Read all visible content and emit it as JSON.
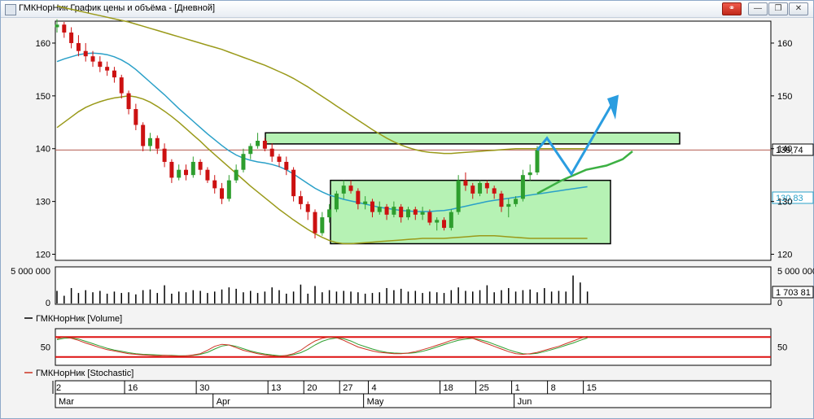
{
  "window": {
    "title": "ГМКНорНик График цены и объёма - [Дневной]",
    "buttons": [
      "link-icon",
      "minimize-icon",
      "restore-icon",
      "close-icon"
    ]
  },
  "colors": {
    "up": "#2e9e2e",
    "down": "#cc1111",
    "ma": "#2aa0c8",
    "bands": "#9a9a1a",
    "forecast_green": "#3cb043",
    "forecast_blue": "#2a9de0",
    "zone_fill": "#b6f2b4",
    "level_line": "#b55b50",
    "stoch_bounds": "#dd1111",
    "stoch_k": "#cc3322",
    "stoch_d": "#2e9e2e"
  },
  "chart_data": [
    {
      "type": "candlestick",
      "title": "ГМКНорНик",
      "y_ticks_left": [
        "160",
        "150",
        "140",
        "130",
        "120"
      ],
      "y_ticks_right": [
        "160",
        "150",
        "140",
        "130",
        "120"
      ],
      "ylim": [
        119,
        164
      ],
      "last_price_label": "139,74",
      "ma_label": "130,83",
      "horizontal_level": 139.74,
      "x": [
        "2",
        "3",
        "4",
        "5",
        "6",
        "9",
        "10",
        "11",
        "12",
        "13",
        "16",
        "17",
        "18",
        "19",
        "20",
        "23",
        "24",
        "25",
        "26",
        "27",
        "30",
        "31",
        "1",
        "2",
        "3",
        "6",
        "7",
        "8",
        "9",
        "10",
        "13",
        "14",
        "15",
        "16",
        "17",
        "20",
        "21",
        "22",
        "23",
        "24",
        "27",
        "28",
        "29",
        "30",
        "4",
        "5",
        "6",
        "7",
        "8",
        "11",
        "12",
        "13",
        "14",
        "15",
        "18",
        "19",
        "20",
        "21",
        "22",
        "25",
        "26",
        "27",
        "28",
        "29",
        "1",
        "2",
        "3",
        "4",
        "5",
        "8",
        "9",
        "10",
        "11",
        "12",
        "15"
      ],
      "ohlc": [
        [
          163,
          164.5,
          162,
          163.5
        ],
        [
          163.5,
          164,
          161,
          162
        ],
        [
          162,
          163,
          159,
          160
        ],
        [
          160,
          161.5,
          157.5,
          158.5
        ],
        [
          158.5,
          160,
          156.5,
          157.5
        ],
        [
          157.5,
          158.5,
          155.5,
          156.5
        ],
        [
          156.5,
          157.5,
          154.5,
          155.5
        ],
        [
          155.5,
          156.5,
          153.8,
          154.8
        ],
        [
          154.8,
          155.5,
          152.5,
          153.5
        ],
        [
          153.5,
          154,
          149.5,
          150.5
        ],
        [
          150.5,
          151,
          146.5,
          147.5
        ],
        [
          147.5,
          148.5,
          143.5,
          144.5
        ],
        [
          144.5,
          145,
          139.5,
          140.5
        ],
        [
          140.5,
          143,
          139.5,
          142
        ],
        [
          142,
          142.5,
          139,
          140
        ],
        [
          140,
          141,
          136.5,
          137.5
        ],
        [
          137.5,
          138,
          133.5,
          134.5
        ],
        [
          134.5,
          137,
          134,
          136
        ],
        [
          136,
          137,
          134,
          135
        ],
        [
          135,
          138.5,
          134.5,
          137.5
        ],
        [
          137.5,
          138,
          135,
          136
        ],
        [
          136,
          136.5,
          133.5,
          134
        ],
        [
          134,
          135,
          131.5,
          132.5
        ],
        [
          132.5,
          133.5,
          129.5,
          130.5
        ],
        [
          130.5,
          135,
          130,
          134
        ],
        [
          134,
          137,
          133.5,
          136
        ],
        [
          136,
          140,
          135.5,
          139
        ],
        [
          139,
          141,
          138,
          140.5
        ],
        [
          140.5,
          143,
          140,
          141.5
        ],
        [
          141.5,
          142,
          139.5,
          140
        ],
        [
          140,
          141,
          137.5,
          138.5
        ],
        [
          138.5,
          139,
          136.5,
          137.5
        ],
        [
          137.5,
          138.5,
          135,
          136
        ],
        [
          136,
          136.5,
          130,
          131
        ],
        [
          131,
          132,
          128.5,
          129.5
        ],
        [
          129.5,
          130,
          126.5,
          128
        ],
        [
          128,
          128.5,
          123,
          124
        ],
        [
          124,
          128,
          123.5,
          127
        ],
        [
          127,
          129.5,
          126,
          128.5
        ],
        [
          128.5,
          132,
          128,
          131.5
        ],
        [
          131.5,
          134,
          130.5,
          133
        ],
        [
          133,
          134,
          131.5,
          132
        ],
        [
          132,
          132.5,
          128.5,
          129.5
        ],
        [
          129.5,
          131,
          128.5,
          130
        ],
        [
          130,
          130.5,
          127,
          128
        ],
        [
          128,
          130,
          127.5,
          129
        ],
        [
          129,
          129.5,
          126.5,
          127.5
        ],
        [
          127.5,
          130,
          127,
          129
        ],
        [
          129,
          129.5,
          126,
          127
        ],
        [
          127,
          129,
          126.5,
          128.5
        ],
        [
          128.5,
          129,
          126.5,
          127.5
        ],
        [
          127.5,
          129,
          126.5,
          128
        ],
        [
          128,
          128.5,
          125.5,
          126
        ],
        [
          126,
          127,
          124.5,
          126.5
        ],
        [
          126.5,
          127,
          124.5,
          125
        ],
        [
          125,
          128.5,
          124.5,
          128
        ],
        [
          128,
          135,
          127.5,
          134
        ],
        [
          134,
          135.5,
          132,
          133
        ],
        [
          133,
          133.5,
          130.5,
          131.5
        ],
        [
          131.5,
          134,
          131,
          133.5
        ],
        [
          133.5,
          134,
          131.5,
          132.5
        ],
        [
          132.5,
          133,
          130.5,
          131.5
        ],
        [
          131.5,
          132,
          128,
          129
        ],
        [
          129,
          130.5,
          127,
          129.5
        ],
        [
          129.5,
          131,
          129,
          130.5
        ],
        [
          130.5,
          136,
          130,
          135
        ],
        [
          135,
          137,
          134,
          135.5
        ],
        [
          135.5,
          140.5,
          135,
          139.74
        ]
      ],
      "ma": [
        156.5,
        157,
        157.4,
        157.8,
        158,
        158.1,
        158,
        157.8,
        157.4,
        156.8,
        156,
        155,
        153.8,
        152.6,
        151.4,
        150.2,
        148.9,
        147.6,
        146.4,
        145.2,
        144,
        142.8,
        141.7,
        140.6,
        139.6,
        138.8,
        138.2,
        137.8,
        137.5,
        137.3,
        137,
        136.6,
        136,
        135.2,
        134.3,
        133.4,
        132.5,
        131.8,
        131.2,
        130.8,
        130.4,
        130.1,
        129.8,
        129.5,
        129.2,
        128.9,
        128.7,
        128.5,
        128.3,
        128.2,
        128.1,
        128.1,
        128.1,
        128.2,
        128.3,
        128.5,
        128.8,
        129.1,
        129.4,
        129.7,
        130,
        130.2,
        130.4,
        130.6,
        130.8,
        131,
        131.2,
        131.4,
        131.6,
        131.8,
        132,
        132.2,
        132.4,
        132.6,
        132.8
      ],
      "upper_band": [
        167,
        166.7,
        166.4,
        166.1,
        165.8,
        165.5,
        165.2,
        164.9,
        164.6,
        164.3,
        164,
        163.6,
        163.2,
        162.8,
        162.4,
        162,
        161.6,
        161.2,
        160.8,
        160.4,
        160,
        159.6,
        159.2,
        158.8,
        158.3,
        157.8,
        157.3,
        156.8,
        156.3,
        155.8,
        155.2,
        154.6,
        154,
        153.3,
        152.5,
        151.7,
        150.8,
        149.9,
        149,
        148.1,
        147.2,
        146.3,
        145.4,
        144.5,
        143.6,
        142.8,
        142,
        141.3,
        140.7,
        140.2,
        139.8,
        139.5,
        139.3,
        139.2,
        139.1,
        139.1,
        139.2,
        139.3,
        139.4,
        139.5,
        139.6,
        139.7,
        139.8,
        139.9,
        140,
        140,
        140,
        140,
        140,
        140,
        140,
        140,
        140,
        140,
        140
      ],
      "lower_band": [
        144,
        145,
        146,
        147,
        147.8,
        148.4,
        148.9,
        149.3,
        149.6,
        149.8,
        150,
        149.8,
        149.4,
        148.8,
        148,
        147.1,
        146.1,
        145,
        143.8,
        142.6,
        141.4,
        140.1,
        138.9,
        137.7,
        136.5,
        135.3,
        134.1,
        132.9,
        131.8,
        130.7,
        129.6,
        128.5,
        127.5,
        126.5,
        125.6,
        124.7,
        123.9,
        123.2,
        122.6,
        122.2,
        122,
        122,
        122.1,
        122.2,
        122.3,
        122.4,
        122.5,
        122.6,
        122.7,
        122.8,
        122.9,
        123,
        123,
        123,
        123,
        123.1,
        123.2,
        123.3,
        123.4,
        123.5,
        123.5,
        123.5,
        123.4,
        123.3,
        123.2,
        123.1,
        123,
        123,
        123,
        123,
        123,
        123,
        123,
        123,
        123
      ],
      "green_zone_top": [
        140.9,
        143
      ],
      "green_zone_range": [
        122,
        134
      ]
    },
    {
      "type": "bar",
      "title": "ГМКНорНик [Volume]",
      "y_ticks_left": [
        "5 000 000",
        "0"
      ],
      "y_ticks_right": [
        "5 000 000",
        "0"
      ],
      "last_value_label": "1 703 81",
      "ylim": [
        0,
        5000000
      ],
      "values": [
        1800000,
        1100000,
        2200000,
        1500000,
        1900000,
        1600000,
        1800000,
        1400000,
        1700000,
        1500000,
        1600000,
        1300000,
        1900000,
        2000000,
        1500000,
        2600000,
        1400000,
        1700000,
        1600000,
        1900000,
        1800000,
        1500000,
        1700000,
        2000000,
        2300000,
        2100000,
        1600000,
        1800000,
        1500000,
        1700000,
        2300000,
        1900000,
        1400000,
        1700000,
        2700000,
        1400000,
        2500000,
        1600000,
        1900000,
        1700000,
        1800000,
        1700000,
        1600000,
        1400000,
        1500000,
        1600000,
        2200000,
        1900000,
        2100000,
        1700000,
        1800000,
        1500000,
        1700000,
        1600000,
        1500000,
        1900000,
        2300000,
        1800000,
        1700000,
        1900000,
        2600000,
        1600000,
        1900000,
        2200000,
        1700000,
        1900000,
        2000000,
        1600000,
        2200000,
        1700000,
        1800000,
        1700000,
        4000000,
        3000000,
        1703810
      ]
    },
    {
      "type": "line",
      "title": "ГМКНорНик [Stochastic]",
      "y_ticks_left": [
        "50"
      ],
      "y_ticks_right": [
        "50"
      ],
      "ylim": [
        0,
        100
      ],
      "levels": [
        80,
        20
      ],
      "k": [
        75,
        80,
        76,
        70,
        62,
        55,
        48,
        42,
        38,
        34,
        30,
        28,
        26,
        25,
        24,
        25,
        24,
        23,
        24,
        26,
        30,
        40,
        52,
        58,
        56,
        48,
        40,
        35,
        30,
        26,
        24,
        22,
        25,
        30,
        40,
        55,
        68,
        76,
        80,
        78,
        70,
        60,
        50,
        44,
        38,
        34,
        32,
        30,
        30,
        32,
        36,
        42,
        48,
        55,
        62,
        70,
        75,
        78,
        76,
        68,
        60,
        52,
        44,
        36,
        30,
        28,
        30,
        34,
        40,
        46,
        52,
        60,
        68,
        76,
        82
      ],
      "d": [
        72,
        76,
        77,
        74,
        67,
        60,
        53,
        46,
        41,
        37,
        33,
        30,
        28,
        27,
        26,
        25,
        25,
        24,
        24,
        25,
        28,
        34,
        44,
        53,
        56,
        52,
        45,
        38,
        33,
        29,
        26,
        24,
        24,
        27,
        33,
        43,
        56,
        67,
        74,
        77,
        75,
        68,
        58,
        51,
        44,
        38,
        34,
        32,
        31,
        31,
        33,
        37,
        43,
        50,
        57,
        64,
        70,
        74,
        76,
        72,
        66,
        58,
        50,
        42,
        35,
        30,
        29,
        31,
        36,
        42,
        48,
        55,
        62,
        70,
        77
      ]
    }
  ],
  "x_axis": {
    "day_labels": [
      "2",
      "16",
      "30",
      "13",
      "20",
      "27",
      "4",
      "18",
      "25",
      "1",
      "8",
      "15"
    ],
    "month_labels": [
      "Mar",
      "Apr",
      "May",
      "Jun"
    ]
  }
}
